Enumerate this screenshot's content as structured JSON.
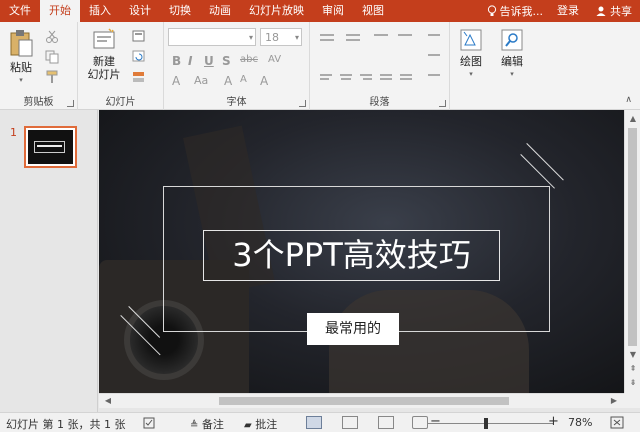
{
  "tabs": [
    "文件",
    "开始",
    "插入",
    "设计",
    "切换",
    "动画",
    "幻灯片放映",
    "审阅",
    "视图"
  ],
  "active_tab_index": 1,
  "tell_me": "告诉我...",
  "login": "登录",
  "share": "共享",
  "ribbon": {
    "clipboard": {
      "paste": "粘贴",
      "label": "剪贴板"
    },
    "slides": {
      "new_slide_line1": "新建",
      "new_slide_line2": "幻灯片",
      "label": "幻灯片"
    },
    "font": {
      "size": "18",
      "label": "字体"
    },
    "paragraph": {
      "label": "段落"
    },
    "drawing": {
      "label": "绘图"
    },
    "editing": {
      "label": "编辑"
    }
  },
  "thumbnails": [
    {
      "number": "1"
    }
  ],
  "slide": {
    "title": "3个PPT高效技巧",
    "subtitle": "最常用的"
  },
  "status": {
    "slide_info": "幻灯片 第 1 张，共 1 张",
    "notes": "备注",
    "comments": "批注",
    "zoom": "78%"
  },
  "colors": {
    "accent": "#c43e1c"
  }
}
